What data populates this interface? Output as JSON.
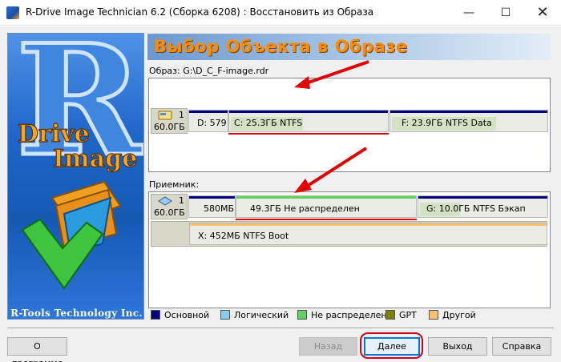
{
  "window": {
    "title": "R-Drive Image Technician 6.2 (Сборка 6208) : Восстановить из Образа",
    "minimize": "—",
    "maximize": "☐",
    "close": "✕"
  },
  "logo": {
    "company": "R-Tools Technology Inc.",
    "brand_letter": "R",
    "brand_word1": "Drive",
    "brand_word2": "Image"
  },
  "header": {
    "title": "Выбор Объекта в Образе"
  },
  "source": {
    "label": "Образ:  G:\\D_C_F-image.rdr",
    "disk": {
      "number": "1",
      "size": "60.0ГБ"
    },
    "partitions": [
      {
        "text": "D: 579"
      },
      {
        "text": "C: 25.3ГБ  NTFS"
      },
      {
        "text": "F: 23.9ГБ  NTFS  Data"
      }
    ]
  },
  "destination": {
    "label": "Приемник:",
    "disk": {
      "number": "1",
      "size": "60.0ГБ"
    },
    "partitions": [
      {
        "text": "580МБ"
      },
      {
        "text": "49.3ГБ  Не распределен"
      },
      {
        "text": "G: 10.0ГБ  NTFS  Бэкап"
      }
    ],
    "extended_partition": {
      "text": "X: 452МБ  NTFS  Boot"
    }
  },
  "legend": [
    {
      "label": "Основной",
      "color": "#000080"
    },
    {
      "label": "Логический",
      "color": "#87ceeb"
    },
    {
      "label": "Не распределен",
      "color": "#5fd35f"
    },
    {
      "label": "GPT",
      "color": "#808000"
    },
    {
      "label": "Другой",
      "color": "#ffc170"
    }
  ],
  "buttons": {
    "about": "О программе",
    "back": "Назад",
    "next": "Далее",
    "exit": "Выход",
    "help": "Справка"
  },
  "colors": {
    "primary_bar": "#000080",
    "unallocated_bar": "#5fd35f",
    "other_bar": "#ffc170",
    "annotation_red": "#e00000",
    "header_title": "#ff8c00"
  }
}
